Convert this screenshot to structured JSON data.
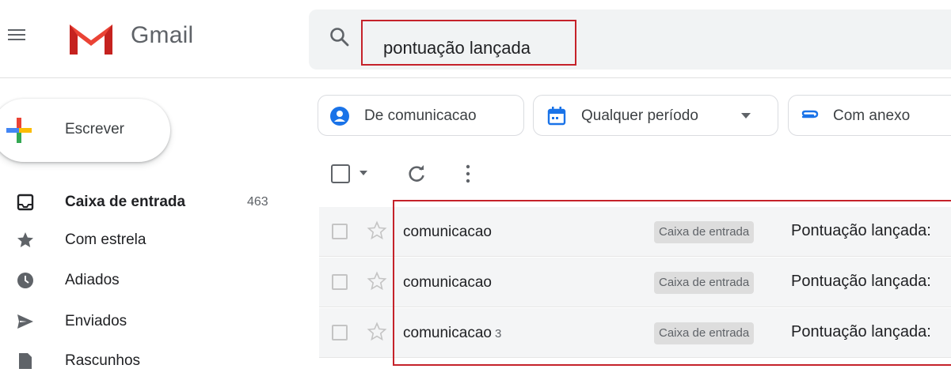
{
  "app": {
    "name": "Gmail"
  },
  "search": {
    "value": "pontuação lançada"
  },
  "compose": {
    "label": "Escrever"
  },
  "sidebar": {
    "items": [
      {
        "label": "Caixa de entrada",
        "count": "463",
        "icon": "inbox-icon",
        "active": true
      },
      {
        "label": "Com estrela",
        "icon": "star-icon"
      },
      {
        "label": "Adiados",
        "icon": "clock-icon"
      },
      {
        "label": "Enviados",
        "icon": "send-icon"
      },
      {
        "label": "Rascunhos",
        "icon": "draft-icon"
      }
    ]
  },
  "filters": {
    "chips": [
      {
        "label": "De comunicacao",
        "icon": "person-icon"
      },
      {
        "label": "Qualquer período",
        "icon": "calendar-icon",
        "dropdown": true
      },
      {
        "label": "Com anexo",
        "icon": "attachment-icon"
      }
    ]
  },
  "emails": [
    {
      "sender": "comunicacao",
      "count": "",
      "label": "Caixa de entrada",
      "subject": "Pontuação lançada:"
    },
    {
      "sender": "comunicacao",
      "count": "",
      "label": "Caixa de entrada",
      "subject": "Pontuação lançada:"
    },
    {
      "sender": "comunicacao",
      "count": "3",
      "label": "Caixa de entrada",
      "subject": "Pontuação lançada:"
    }
  ],
  "colors": {
    "highlight": "#c5222a",
    "accent_blue": "#1a73e8",
    "gmail_red": "#ea4335"
  }
}
